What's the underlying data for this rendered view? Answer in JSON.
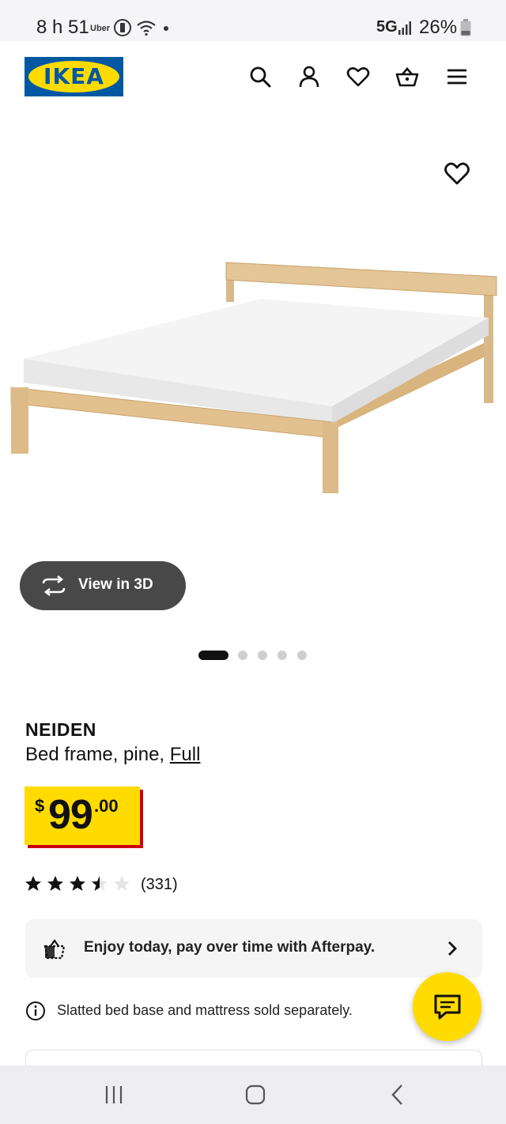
{
  "status_bar": {
    "time": "8 h 51",
    "app_label": "Uber",
    "network": "5G",
    "battery": "26%"
  },
  "header": {
    "logo_text": "IKEA",
    "icons": [
      "search-icon",
      "account-icon",
      "favorites-icon",
      "basket-icon",
      "menu-icon"
    ]
  },
  "gallery": {
    "view_3d_label": "View in 3D",
    "image_count": 5,
    "active_index": 0
  },
  "product": {
    "name": "NEIDEN",
    "description": "Bed frame, pine, ",
    "size": "Full",
    "price": {
      "currency": "$",
      "main": "99",
      "cents": ".00"
    },
    "rating": {
      "stars": 3.5,
      "max": 5,
      "count": "(331)"
    }
  },
  "afterpay": {
    "text": "Enjoy today, pay over time with Afterpay."
  },
  "notice": {
    "text": "Slatted bed base and mattress sold separately."
  },
  "colors": {
    "ikea_blue": "#0058a3",
    "ikea_yellow": "#ffdb00",
    "price_shadow": "#cc0008",
    "view3d_bg": "#484848"
  }
}
